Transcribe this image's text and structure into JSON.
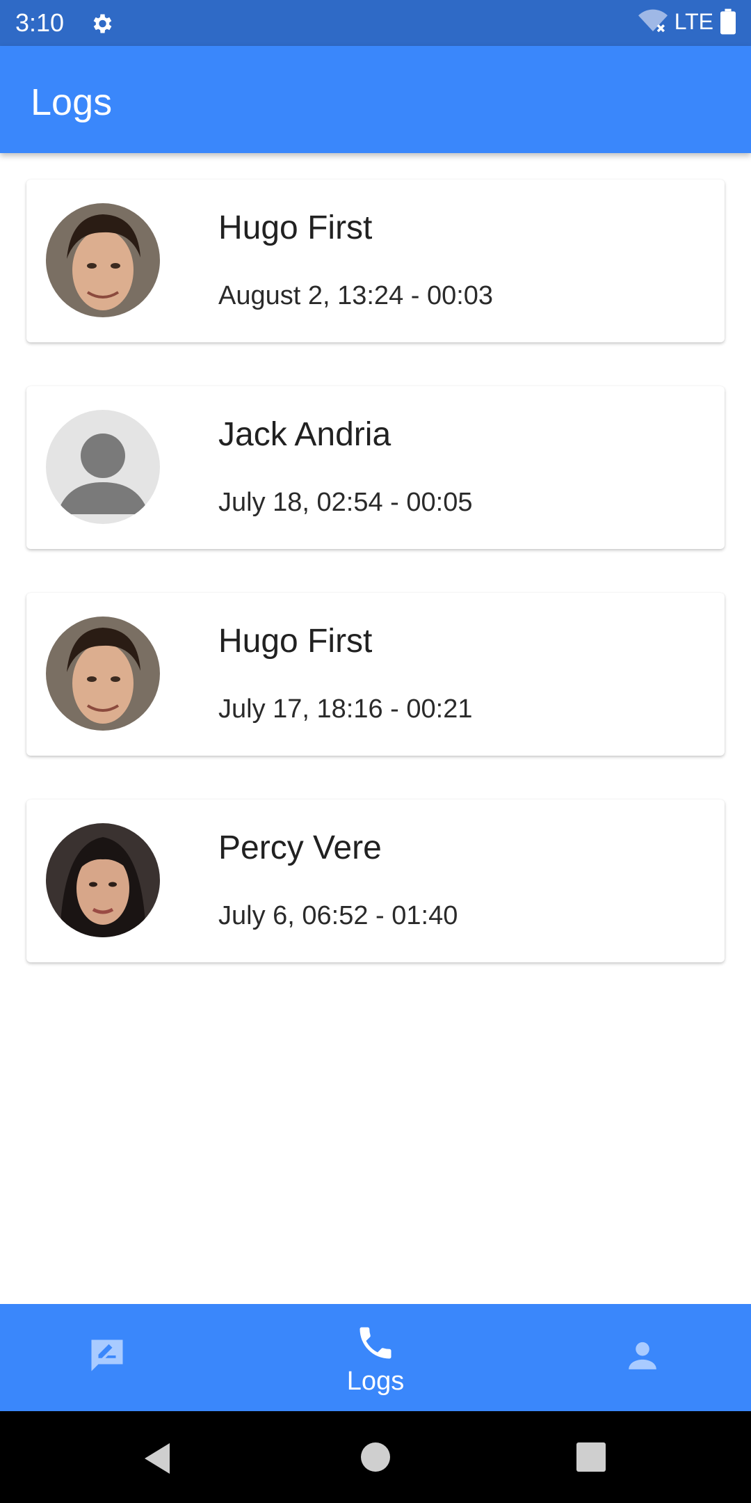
{
  "status_bar": {
    "time": "3:10",
    "network": "LTE",
    "icons": [
      "gear-icon",
      "wifi-off-icon",
      "battery-icon"
    ]
  },
  "app_bar": {
    "title": "Logs"
  },
  "logs": [
    {
      "name": "Hugo First",
      "date": "August 2, 13:24",
      "duration": "00:03",
      "meta": "August 2, 13:24  -  00:03",
      "avatar": "photo"
    },
    {
      "name": "Jack Andria",
      "date": "July 18, 02:54",
      "duration": "00:05",
      "meta": "July 18, 02:54  -  00:05",
      "avatar": "placeholder"
    },
    {
      "name": "Hugo First",
      "date": "July 17, 18:16",
      "duration": "00:21",
      "meta": "July 17, 18:16  -  00:21",
      "avatar": "photo"
    },
    {
      "name": "Percy Vere",
      "date": "July 6, 06:52",
      "duration": "01:40",
      "meta": "July 6, 06:52  -  01:40",
      "avatar": "photo"
    }
  ],
  "bottom_nav": {
    "items": [
      {
        "icon": "message-edit-icon",
        "label": "",
        "active": false
      },
      {
        "icon": "phone-icon",
        "label": "Logs",
        "active": true
      },
      {
        "icon": "person-icon",
        "label": "",
        "active": false
      }
    ]
  },
  "colors": {
    "status_bar": "#2f6ac6",
    "primary": "#3a87fb",
    "inactive_icon": "#a9cbff"
  }
}
